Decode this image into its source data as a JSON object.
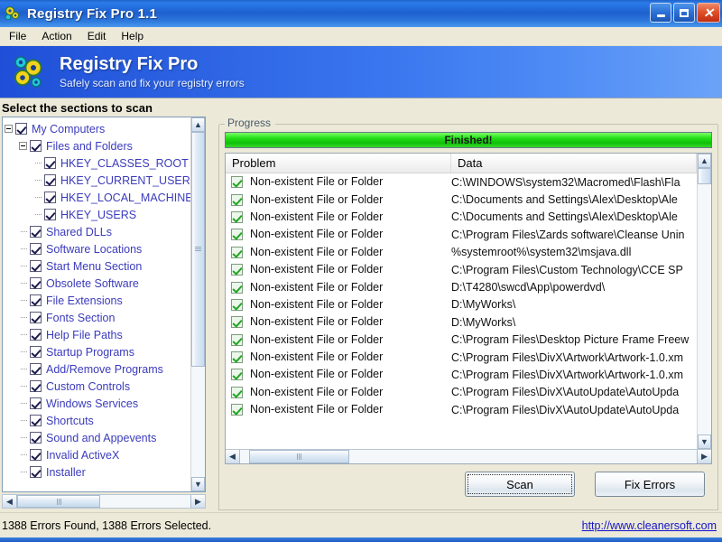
{
  "window": {
    "title": "Registry Fix Pro 1.1",
    "icon": "gears-icon",
    "controls": {
      "minimize": "minimize-icon",
      "maximize": "maximize-icon",
      "close": "close-icon"
    }
  },
  "menu": {
    "items": [
      "File",
      "Action",
      "Edit",
      "Help"
    ]
  },
  "banner": {
    "icon": "gears-icon",
    "title": "Registry Fix Pro",
    "subtitle": "Safely scan and fix your registry errors"
  },
  "sections": {
    "caption": "Select the sections to scan",
    "tree": [
      {
        "label": "My Computers",
        "level": 0,
        "expander": true,
        "checked": true
      },
      {
        "label": "Files and Folders",
        "level": 1,
        "expander": true,
        "checked": true
      },
      {
        "label": "HKEY_CLASSES_ROOT",
        "level": 2,
        "expander": false,
        "checked": true
      },
      {
        "label": "HKEY_CURRENT_USER",
        "level": 2,
        "expander": false,
        "checked": true
      },
      {
        "label": "HKEY_LOCAL_MACHINE",
        "level": 2,
        "expander": false,
        "checked": true
      },
      {
        "label": "HKEY_USERS",
        "level": 2,
        "expander": false,
        "checked": true
      },
      {
        "label": "Shared DLLs",
        "level": 1,
        "expander": false,
        "checked": true
      },
      {
        "label": "Software Locations",
        "level": 1,
        "expander": false,
        "checked": true
      },
      {
        "label": "Start Menu Section",
        "level": 1,
        "expander": false,
        "checked": true
      },
      {
        "label": "Obsolete Software",
        "level": 1,
        "expander": false,
        "checked": true
      },
      {
        "label": "File Extensions",
        "level": 1,
        "expander": false,
        "checked": true
      },
      {
        "label": "Fonts Section",
        "level": 1,
        "expander": false,
        "checked": true
      },
      {
        "label": "Help File Paths",
        "level": 1,
        "expander": false,
        "checked": true
      },
      {
        "label": "Startup Programs",
        "level": 1,
        "expander": false,
        "checked": true
      },
      {
        "label": "Add/Remove Programs",
        "level": 1,
        "expander": false,
        "checked": true
      },
      {
        "label": "Custom Controls",
        "level": 1,
        "expander": false,
        "checked": true
      },
      {
        "label": "Windows Services",
        "level": 1,
        "expander": false,
        "checked": true
      },
      {
        "label": "Shortcuts",
        "level": 1,
        "expander": false,
        "checked": true
      },
      {
        "label": "Sound and Appevents",
        "level": 1,
        "expander": false,
        "checked": true
      },
      {
        "label": "Invalid ActiveX",
        "level": 1,
        "expander": false,
        "checked": true
      },
      {
        "label": "Installer",
        "level": 1,
        "expander": false,
        "checked": true
      }
    ]
  },
  "progress": {
    "group_label": "Progress",
    "percent": 100,
    "status_text": "Finished!"
  },
  "results": {
    "columns": [
      "Problem",
      "Data"
    ],
    "rows": [
      {
        "checked": true,
        "problem": "Non-existent File or Folder",
        "data": "C:\\WINDOWS\\system32\\Macromed\\Flash\\Fla"
      },
      {
        "checked": true,
        "problem": "Non-existent File or Folder",
        "data": "C:\\Documents and Settings\\Alex\\Desktop\\Ale"
      },
      {
        "checked": true,
        "problem": "Non-existent File or Folder",
        "data": "C:\\Documents and Settings\\Alex\\Desktop\\Ale"
      },
      {
        "checked": true,
        "problem": "Non-existent File or Folder",
        "data": "C:\\Program Files\\Zards software\\Cleanse Unin"
      },
      {
        "checked": true,
        "problem": "Non-existent File or Folder",
        "data": "%systemroot%\\system32\\msjava.dll"
      },
      {
        "checked": true,
        "problem": "Non-existent File or Folder",
        "data": "C:\\Program Files\\Custom Technology\\CCE SP"
      },
      {
        "checked": true,
        "problem": "Non-existent File or Folder",
        "data": "D:\\T4280\\swcd\\App\\powerdvd\\"
      },
      {
        "checked": true,
        "problem": "Non-existent File or Folder",
        "data": "D:\\MyWorks\\"
      },
      {
        "checked": true,
        "problem": "Non-existent File or Folder",
        "data": "D:\\MyWorks\\"
      },
      {
        "checked": true,
        "problem": "Non-existent File or Folder",
        "data": "C:\\Program Files\\Desktop Picture Frame Freew"
      },
      {
        "checked": true,
        "problem": "Non-existent File or Folder",
        "data": "C:\\Program Files\\DivX\\Artwork\\Artwork-1.0.xm"
      },
      {
        "checked": true,
        "problem": "Non-existent File or Folder",
        "data": "C:\\Program Files\\DivX\\Artwork\\Artwork-1.0.xm"
      },
      {
        "checked": true,
        "problem": "Non-existent File or Folder",
        "data": "C:\\Program Files\\DivX\\AutoUpdate\\AutoUpda"
      },
      {
        "checked": true,
        "problem": "Non-existent File or Folder",
        "data": "C:\\Program Files\\DivX\\AutoUpdate\\AutoUpda"
      }
    ]
  },
  "actions": {
    "scan": "Scan",
    "fix_errors": "Fix Errors"
  },
  "statusbar": {
    "text": "1388 Errors Found,  1388 Errors Selected.",
    "link": "http://www.cleanersoft.com"
  },
  "colors": {
    "title_blue": "#1e5fce",
    "banner_blue": "#3b78ef",
    "progress_green": "#27e21a",
    "tree_text": "#3b3bbd",
    "link": "#1414c8"
  },
  "scroll_icons": {
    "up": "▲",
    "down": "▼",
    "left": "◀",
    "right": "▶"
  }
}
